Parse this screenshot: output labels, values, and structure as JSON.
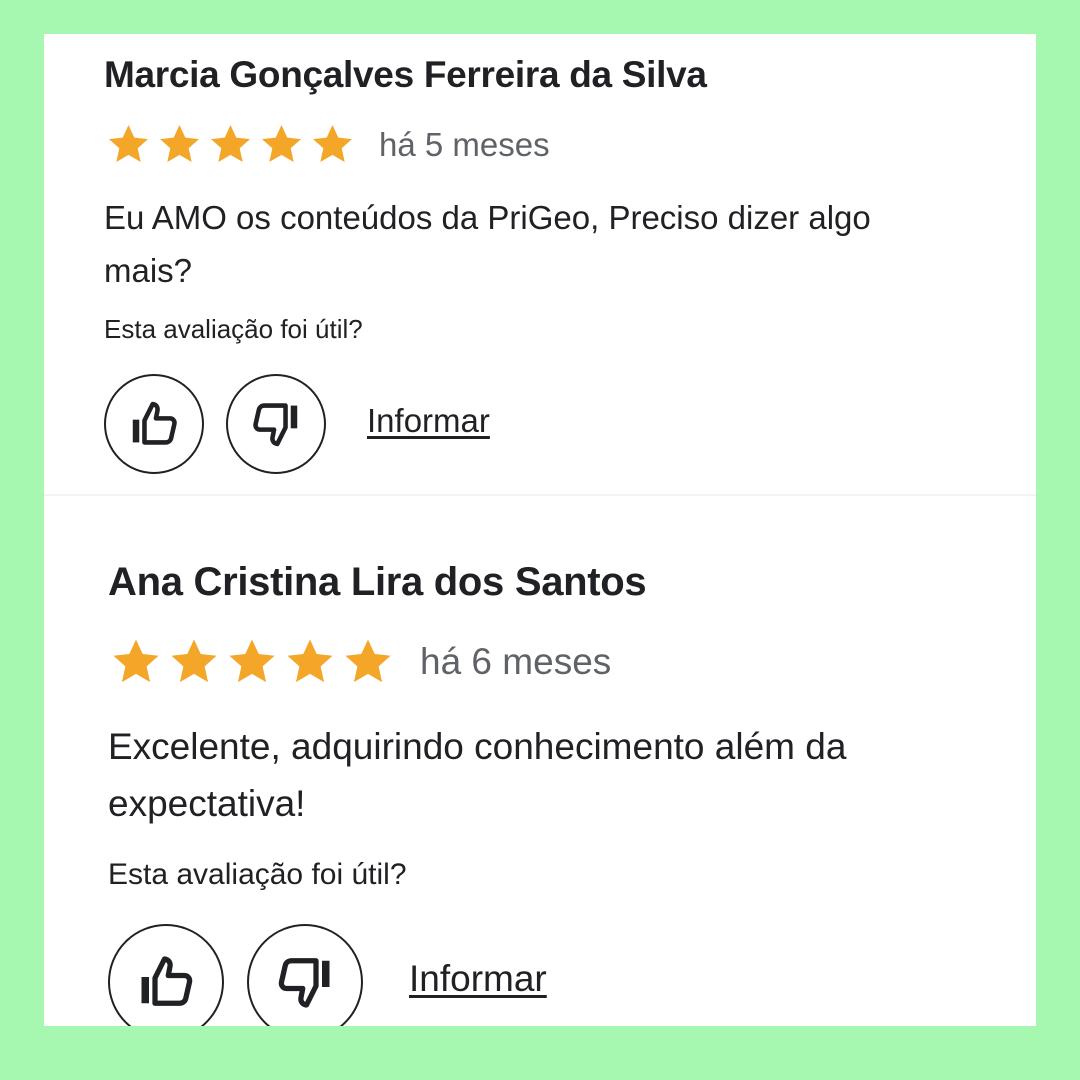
{
  "colors": {
    "background": "#a6f8b1",
    "card": "#ffffff",
    "star": "#f3a628",
    "text": "#202124",
    "secondary_text": "#5f6368"
  },
  "reviews": [
    {
      "author": "Marcia Gonçalves Ferreira da Silva",
      "rating": 5,
      "max_rating": 5,
      "age": "há 5 meses",
      "text": "Eu AMO os conteúdos da PriGeo, Preciso dizer algo mais?",
      "helpful_prompt": "Esta avaliação foi útil?",
      "thumbs_up_icon": "thumbs-up-icon",
      "thumbs_down_icon": "thumbs-down-icon",
      "report_label": "Informar"
    },
    {
      "author": "Ana Cristina Lira dos Santos",
      "rating": 5,
      "max_rating": 5,
      "age": "há 6 meses",
      "text": "Excelente, adquirindo conhecimento além da expectativa!",
      "helpful_prompt": "Esta avaliação foi útil?",
      "thumbs_up_icon": "thumbs-up-icon",
      "thumbs_down_icon": "thumbs-down-icon",
      "report_label": "Informar"
    }
  ]
}
